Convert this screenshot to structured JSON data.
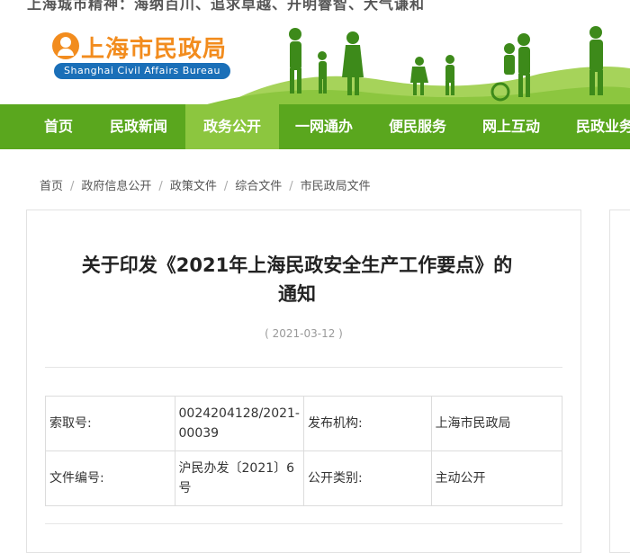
{
  "slogan": "上海城市精神：海纳百川、追求卓越、开明睿智、大气谦和",
  "logo": {
    "name_cn": "上海市民政局",
    "name_en": "Shanghai Civil Affairs Bureau"
  },
  "nav": {
    "items": [
      "首页",
      "民政新闻",
      "政务公开",
      "一网通办",
      "便民服务",
      "网上互动",
      "民政业务"
    ],
    "active": "政务公开"
  },
  "breadcrumb": [
    "首页",
    "政府信息公开",
    "政策文件",
    "综合文件",
    "市民政局文件"
  ],
  "article": {
    "title": "关于印发《2021年上海民政安全生产工作要点》的通知",
    "date": "( 2021-03-12 )",
    "meta": {
      "index_label": "索取号:",
      "index_value": "0024204128/2021-00039",
      "publisher_label": "发布机构:",
      "publisher_value": "上海市民政局",
      "doc_no_label": "文件编号:",
      "doc_no_value": "沪民办发〔2021〕6 号",
      "category_label": "公开类别:",
      "category_value": "主动公开"
    }
  },
  "colors": {
    "nav_bg": "#5aa71e",
    "nav_active": "#8cc63f",
    "logo_orange": "#f28c1e",
    "logo_blue": "#1a6fb8"
  }
}
